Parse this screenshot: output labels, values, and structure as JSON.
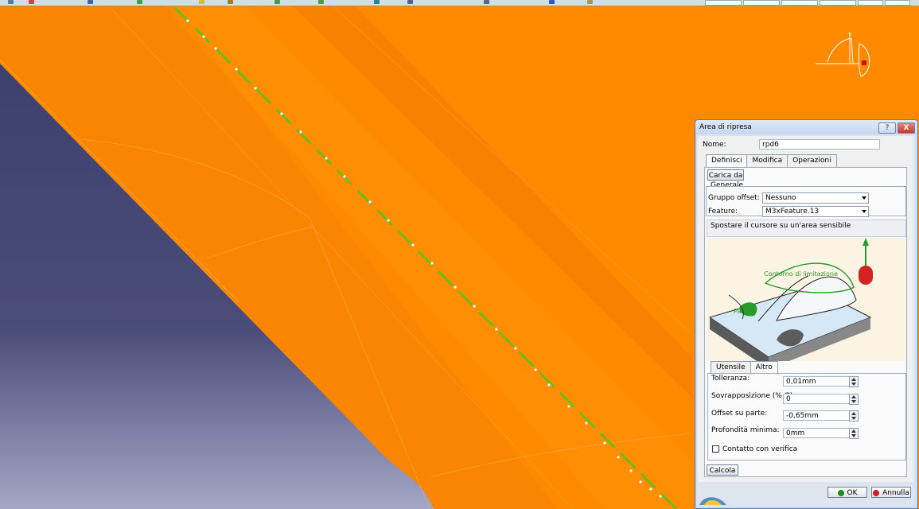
{
  "dialog": {
    "title": "Area di ripresa",
    "help_label": "?",
    "close_label": "X",
    "name_label": "Nome:",
    "name_value": "rpd6",
    "tabs": [
      "Definisci",
      "Modifica",
      "Operazioni"
    ],
    "load_button": "Carica da",
    "general_group": "Generale",
    "offset_group_label": "Gruppo offset:",
    "offset_group_value": "Nessuno",
    "feature_label": "Feature:",
    "feature_value": "M3xFeature.13",
    "hint_text": "Spostare il cursore su un'area sensibile",
    "image_labels": [
      "Contorno di limitazione",
      "Parte"
    ],
    "sub_tabs": [
      "Utensile",
      "Altro"
    ],
    "fields": [
      {
        "label": "Tolleranza:",
        "value": "0,01mm"
      },
      {
        "label": "Sovrapposizione (% Ø):",
        "value": "0"
      },
      {
        "label": "Offset su parte:",
        "value": "-0,65mm"
      },
      {
        "label": "Profondità minima:",
        "value": "0mm"
      }
    ],
    "checkbox_label": "Contatto con verifica",
    "compute_button": "Calcola",
    "ok_button": "OK",
    "cancel_button": "Annulla"
  },
  "colors": {
    "part_orange": "#ff8a00",
    "background_navy": "#3f4170",
    "toolpath_green": "#5ac318",
    "ok_green": "#1a8f1a",
    "cancel_red": "#cc2222"
  }
}
